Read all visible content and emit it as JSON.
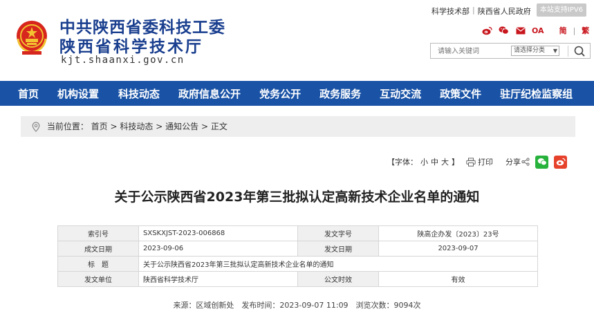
{
  "header": {
    "title_line1": "中共陕西省委科技工委",
    "title_line2": "陕西省科学技术厅",
    "domain": "kjt.shaanxi.gov.cn",
    "toplinks": [
      "科学技术部",
      "陕西省人民政府"
    ],
    "ipv6_badge": "本站支持IPV6",
    "icons": [
      "weibo-icon",
      "wechat-icon",
      "mail-icon"
    ],
    "oa_label": "OA",
    "simplified_label": "简",
    "traditional_label": "繁",
    "search": {
      "placeholder": "请输入关键词",
      "category": "请选择分类"
    }
  },
  "nav": {
    "items": [
      "首页",
      "机构设置",
      "科技动态",
      "政府信息公开",
      "党务公开",
      "政务服务",
      "互动交流",
      "政策文件",
      "驻厅纪检监察组"
    ]
  },
  "breadcrumb": {
    "prefix": "当前位置：",
    "path": [
      "首页",
      "科技动态",
      "通知公告",
      "正文"
    ],
    "sep": ">"
  },
  "tools": {
    "font_label": "【字体：",
    "font_small": "小",
    "font_mid": "中",
    "font_large": "大",
    "font_end": "】",
    "print_label": "打印",
    "share_label": "分享",
    "colors": {
      "wechat": "#27b23c",
      "weibo": "#e6412b"
    }
  },
  "article": {
    "title": "关于公示陕西省2023年第三批拟认定高新技术企业名单的通知"
  },
  "meta": {
    "index_label": "索引号",
    "index_value": "SXSKXJST-2023-006868",
    "docno_label": "发文字号",
    "docno_value": "陕高企办发〔2023〕23号",
    "created_label": "成文日期",
    "created_value": "2023-09-06",
    "issued_label": "发文日期",
    "issued_value": "2023-09-07",
    "title_label": "标　题",
    "title_value": "关于公示陕西省2023年第三批拟认定高新技术企业名单的通知",
    "unit_label": "发文单位",
    "unit_value": "陕西省科学技术厅",
    "status_label": "公文时效",
    "status_value": "有效"
  },
  "source_line": "来源：区域创新处　发布时间：2023-09-07 11:09　浏览次数：9094次",
  "colors": {
    "brand_blue": "#1a53a6",
    "title_blue": "#1a3f8f",
    "accent_red": "#c8161d"
  }
}
